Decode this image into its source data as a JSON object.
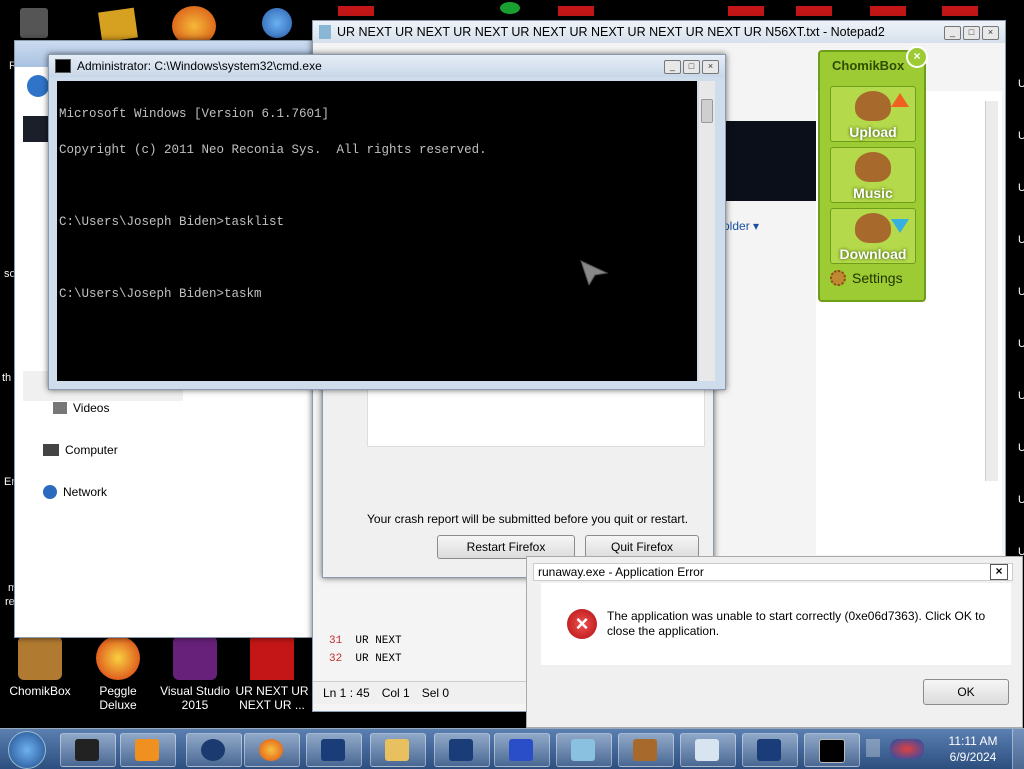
{
  "desktop": {
    "icons": [
      {
        "label": "ChomikBox"
      },
      {
        "label": "Peggle Deluxe"
      },
      {
        "label": "Visual Studio 2015"
      },
      {
        "label": "UR NEXT UR NEXT UR ..."
      }
    ],
    "edge_texts": [
      "R",
      "so",
      "th",
      "Er",
      "m",
      "re"
    ],
    "top_icon_text": "UR"
  },
  "explorer": {
    "nav_items": [
      "Videos",
      "Computer",
      "Network"
    ],
    "folder_label": "older"
  },
  "notepad": {
    "title": "UR NEXT UR NEXT UR NEXT UR NEXT UR NEXT UR NEXT UR NEXT UR N56XT.txt - Notepad2",
    "lines": [
      {
        "num": "31",
        "text": "UR  NEXT"
      },
      {
        "num": "32",
        "text": "UR  NEXT"
      }
    ],
    "status": {
      "ln": "Ln 1 : 45",
      "col": "Col 1",
      "sel": "Sel 0"
    }
  },
  "firefox_crash": {
    "message": "Your crash report will be submitted before you quit or restart.",
    "restart_label": "Restart Firefox",
    "quit_label": "Quit Firefox"
  },
  "cmd": {
    "title": "Administrator: C:\\Windows\\system32\\cmd.exe",
    "lines": [
      "Microsoft Windows [Version 6.1.7601]",
      "Copyright (c) 2011 Neo Reconia Sys.  All rights reserved.",
      "",
      "C:\\Users\\Joseph Biden>tasklist",
      "",
      "C:\\Users\\Joseph Biden>taskm"
    ]
  },
  "chomikbox": {
    "title": "ChomikBox",
    "buttons": [
      "Upload",
      "Music",
      "Download"
    ],
    "settings_label": "Settings",
    "accent": "#9dcb33"
  },
  "error_dialog": {
    "title": "runaway.exe - Application Error",
    "message": "The application was unable to start correctly (0xe06d7363). Click OK to close the application.",
    "ok_label": "OK"
  },
  "taskbar": {
    "time": "11:11 AM",
    "date": "6/9/2024"
  }
}
